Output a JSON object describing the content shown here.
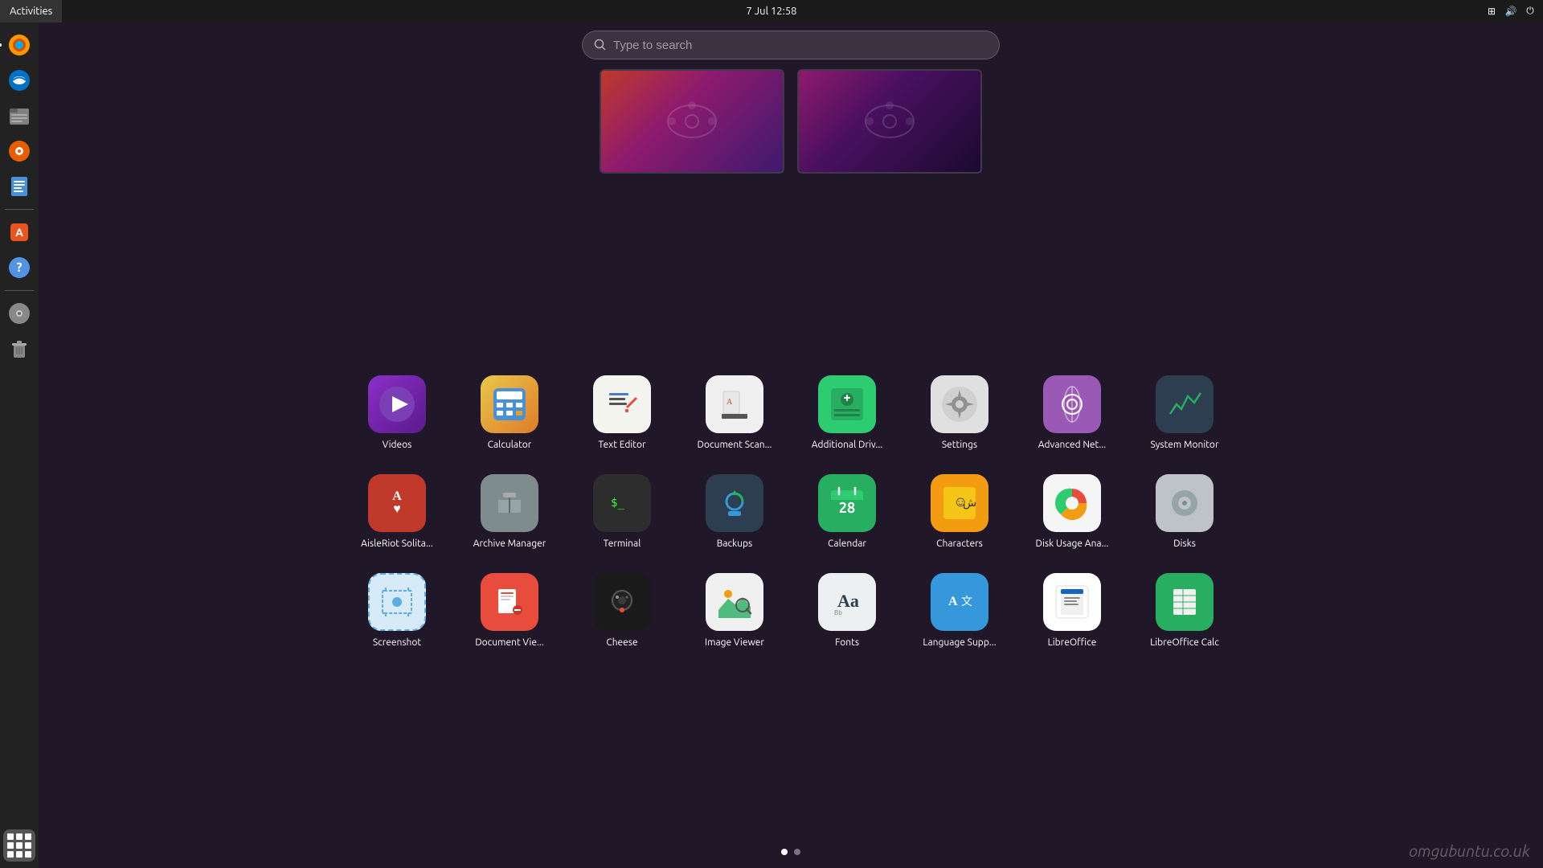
{
  "topbar": {
    "activities_label": "Activities",
    "time": "7 Jul  12:58"
  },
  "search": {
    "placeholder": "Type to search"
  },
  "sidebar": {
    "apps": [
      {
        "name": "firefox",
        "label": "Firefox",
        "active": true
      },
      {
        "name": "thunderbird",
        "label": "Thunderbird",
        "active": false
      },
      {
        "name": "files",
        "label": "Files",
        "active": false
      },
      {
        "name": "rhythmbox",
        "label": "Rhythmbox",
        "active": false
      },
      {
        "name": "writer",
        "label": "LibreOffice Writer",
        "active": false
      },
      {
        "name": "software",
        "label": "Software",
        "active": false
      },
      {
        "name": "help",
        "label": "Help",
        "active": false
      },
      {
        "name": "cdrom",
        "label": "CD/DVD",
        "active": false
      },
      {
        "name": "trash",
        "label": "Trash",
        "active": false
      }
    ]
  },
  "apps_row1": [
    {
      "id": "videos",
      "label": "Videos"
    },
    {
      "id": "calculator",
      "label": "Calculator"
    },
    {
      "id": "texteditor",
      "label": "Text Editor"
    },
    {
      "id": "docscan",
      "label": "Document Scan..."
    },
    {
      "id": "adddrv",
      "label": "Additional Driv..."
    },
    {
      "id": "settings",
      "label": "Settings"
    },
    {
      "id": "advnet",
      "label": "Advanced Net..."
    },
    {
      "id": "sysmon",
      "label": "System Monitor"
    }
  ],
  "apps_row2": [
    {
      "id": "solitaire",
      "label": "AisleRiot Solita..."
    },
    {
      "id": "archman",
      "label": "Archive Manager"
    },
    {
      "id": "terminal",
      "label": "Terminal"
    },
    {
      "id": "backups",
      "label": "Backups"
    },
    {
      "id": "calendar",
      "label": "Calendar"
    },
    {
      "id": "chars",
      "label": "Characters"
    },
    {
      "id": "diskusage",
      "label": "Disk Usage Ana..."
    },
    {
      "id": "disks",
      "label": "Disks"
    }
  ],
  "apps_row3": [
    {
      "id": "screenshot",
      "label": "Screenshot"
    },
    {
      "id": "docview",
      "label": "Document Vie..."
    },
    {
      "id": "cheese",
      "label": "Cheese"
    },
    {
      "id": "imgview",
      "label": "Image Viewer"
    },
    {
      "id": "fonts",
      "label": "Fonts"
    },
    {
      "id": "langsupp",
      "label": "Language Supp..."
    },
    {
      "id": "libreoffice",
      "label": "LibreOffice"
    },
    {
      "id": "librocalc",
      "label": "LibreOffice Calc"
    }
  ],
  "page_dots": [
    {
      "active": true
    },
    {
      "active": false
    }
  ],
  "watermark": "omgubuntu.co.uk"
}
